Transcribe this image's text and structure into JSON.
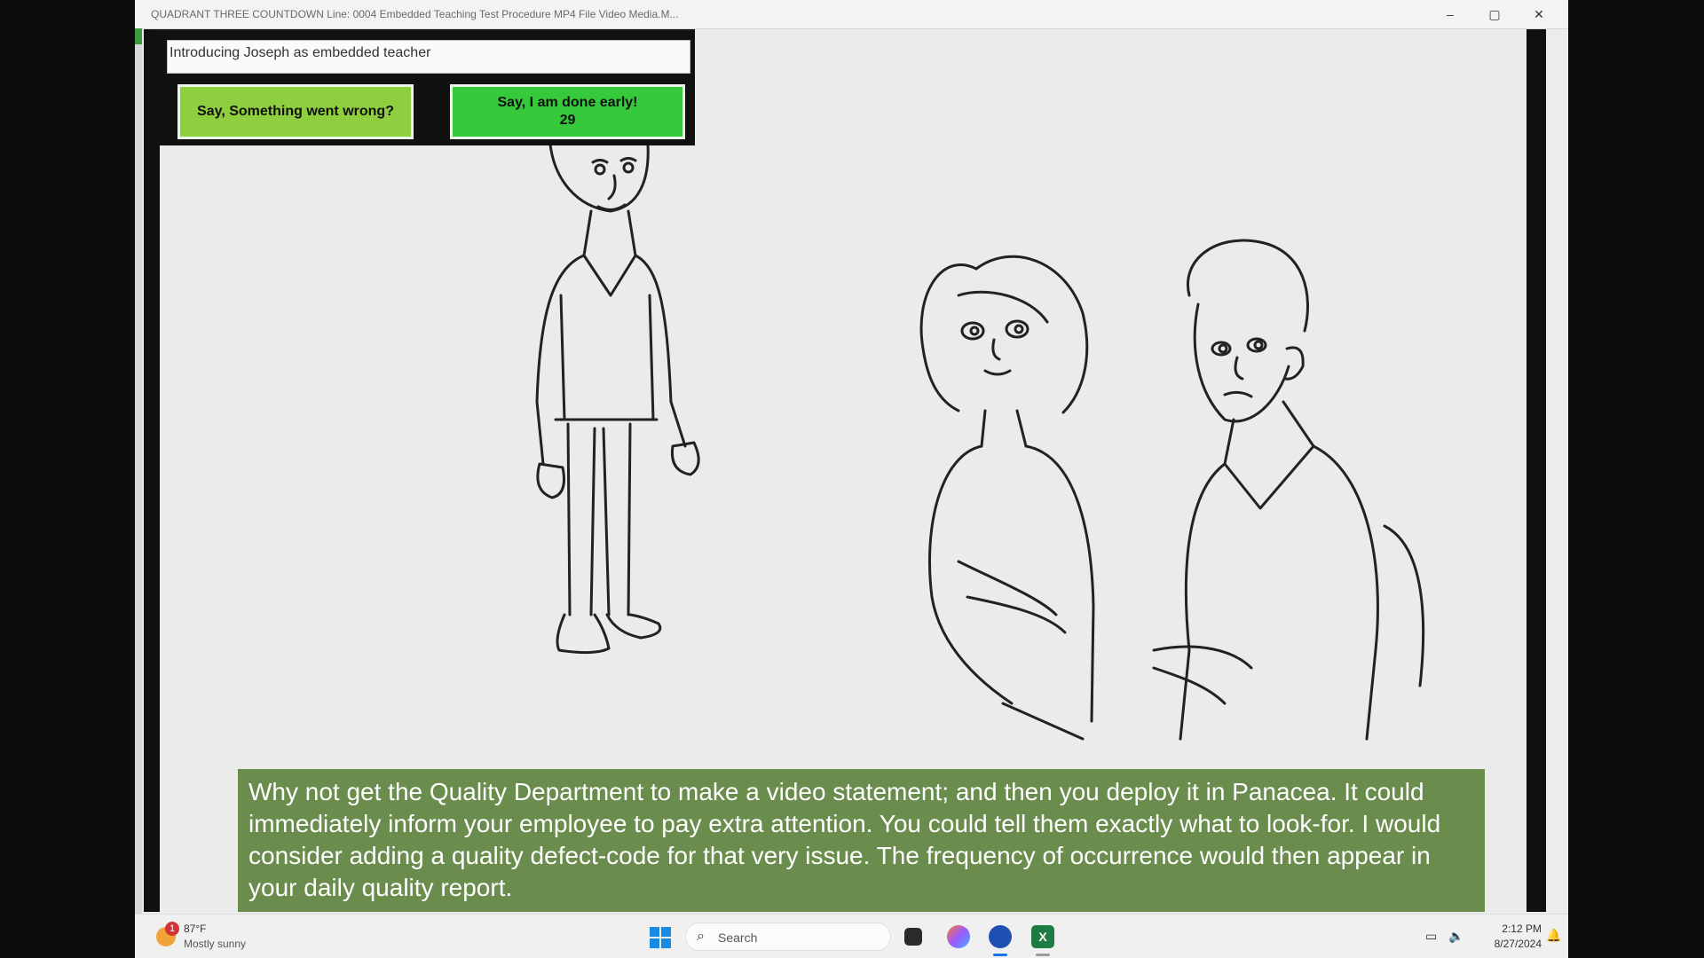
{
  "window": {
    "title": "QUADRANT THREE COUNTDOWN  Line: 0004 Embedded Teaching Test Procedure MP4 File Video Media.M...",
    "min_glyph": "–",
    "max_glyph": "▢",
    "close_glyph": "✕"
  },
  "panel": {
    "title": "Introducing Joseph as embedded teacher",
    "button_wrong_label": "Say, Something went wrong?",
    "button_done_label": "Say, I am done early!",
    "button_done_countdown": "29"
  },
  "caption": {
    "text": "Why not get the Quality Department to make a video statement; and then you deploy it in Panacea. It could immediately inform your employee to pay extra attention. You could tell them exactly what to look-for.  I would consider adding a quality defect-code for that very issue. The frequency of occurrence would then appear in your daily quality report."
  },
  "taskbar": {
    "weather_badge": "1",
    "weather_temp": "87°F",
    "weather_desc": "Mostly sunny",
    "search_label": "Search",
    "search_glyph": "⌕",
    "excel_glyph": "X",
    "time": "2:12 PM",
    "date": "8/27/2024",
    "bell_glyph": "🔔"
  },
  "icons": {
    "window": [
      "minimize-icon",
      "maximize-icon",
      "close-icon"
    ],
    "taskbar": [
      "weather-icon",
      "windows-start-icon",
      "search-icon",
      "file-explorer-icon",
      "copilot-icon",
      "browser-icon",
      "excel-icon",
      "network-icon",
      "volume-icon",
      "notification-bell-icon"
    ]
  },
  "colors": {
    "button_wrong": "#8fce3f",
    "button_done": "#36c93b",
    "caption_bg": "#6a8d4e",
    "accent": "#1a8ae0"
  }
}
